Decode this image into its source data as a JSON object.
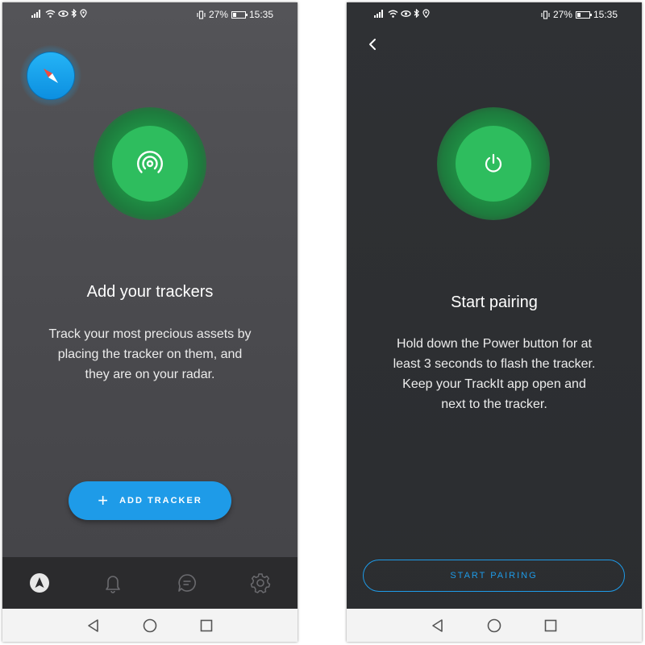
{
  "left_screen": {
    "status": {
      "time": "15:35",
      "battery": "27%",
      "battery_level": 0.27
    },
    "title": "Add your trackers",
    "description": "Track your most precious assets by placing the tracker on them, and they are on your radar.",
    "add_button": {
      "icon": "plus-icon",
      "label": "ADD TRACKER"
    },
    "tabs": [
      {
        "icon": "navigation-arrow-icon",
        "active": true
      },
      {
        "icon": "bell-icon",
        "active": false
      },
      {
        "icon": "chat-icon",
        "active": false
      },
      {
        "icon": "gear-icon",
        "active": false
      }
    ]
  },
  "right_screen": {
    "status": {
      "time": "15:35",
      "battery": "27%",
      "battery_level": 0.27
    },
    "title": "Start pairing",
    "description": "Hold down the Power button for at least 3 seconds to flash the tracker. Keep your TrackIt app open and next to the tracker.",
    "pair_button": {
      "label": "START PAIRING"
    }
  },
  "colors": {
    "accent_blue": "#1e9be8",
    "success_green": "#2ebd5e",
    "left_background": "#4a4a4e",
    "right_background": "#2d2f32",
    "tab_bar": "#2b2b2d",
    "system_nav": "#f3f3f3"
  }
}
